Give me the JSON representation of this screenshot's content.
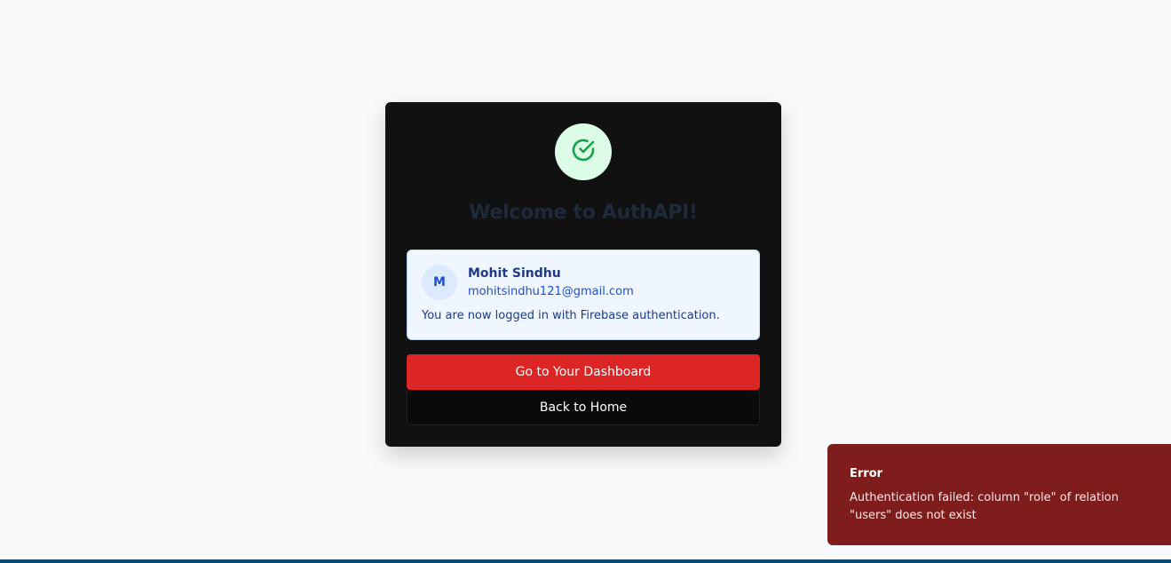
{
  "card": {
    "icon": "check-circle-icon",
    "title": "Welcome to AuthAPI!",
    "user": {
      "avatar_initial": "M",
      "name": "Mohit Sindhu",
      "email": "mohitsindhu121@gmail.com",
      "note": "You are now logged in with Firebase authentication."
    },
    "primary_button": "Go to Your Dashboard",
    "secondary_button": "Back to Home"
  },
  "toast": {
    "title": "Error",
    "message": "Authentication failed: column \"role\" of relation \"users\" does not exist"
  },
  "colors": {
    "card_bg": "#111111",
    "primary": "#dc2626",
    "success": "#16a34a",
    "toast_bg": "#7f1d1d"
  }
}
